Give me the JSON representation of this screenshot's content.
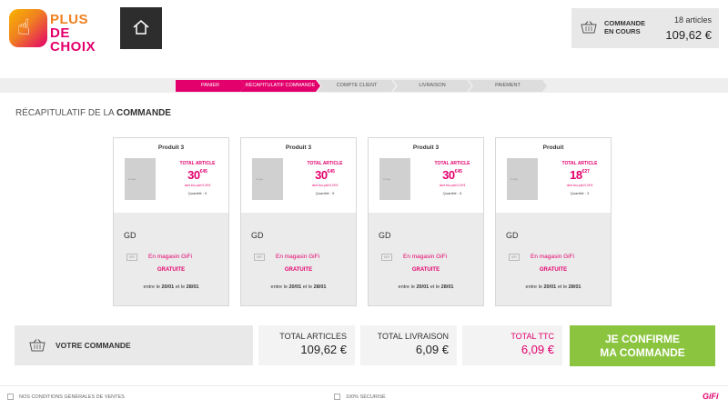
{
  "header": {
    "logo_line1": "PLUS",
    "logo_line2": "DE CHOIX",
    "cart_label": "COMMANDE EN COURS",
    "cart_count": "18 articles",
    "cart_total": "109,62 €"
  },
  "steps": [
    {
      "label": "PANIER",
      "active": true
    },
    {
      "label": "RÉCAPITULATIF COMMANDE",
      "active": true
    },
    {
      "label": "COMPTE CLIENT",
      "active": false
    },
    {
      "label": "LIVRAISON",
      "active": false
    },
    {
      "label": "PAIEMENT",
      "active": false
    }
  ],
  "section": {
    "prefix": "RÉCAPITULATIF DE LA",
    "strong": "COMMANDE"
  },
  "products": [
    {
      "title": "Produit 3",
      "image_text": "image",
      "total_label": "TOTAL ARTICLE",
      "price_int": "30",
      "price_dec": "45",
      "ecopart": "dont éco-part 0,09 €",
      "qty": "Quantité : 5",
      "seller": "GD",
      "gifi_label": "GiFi",
      "store": "En magasin GiFi",
      "shipping": "GRATUITE",
      "date_prefix": "entre le",
      "date_from": "20/01",
      "date_mid": "et le",
      "date_to": "28/01"
    },
    {
      "title": "Produit 3",
      "image_text": "image",
      "total_label": "TOTAL ARTICLE",
      "price_int": "30",
      "price_dec": "45",
      "ecopart": "dont éco-part 0,09 €",
      "qty": "Quantité : 5",
      "seller": "GD",
      "gifi_label": "GiFi",
      "store": "En magasin GiFi",
      "shipping": "GRATUITE",
      "date_prefix": "entre le",
      "date_from": "20/01",
      "date_mid": "et le",
      "date_to": "28/01"
    },
    {
      "title": "Produit 3",
      "image_text": "image",
      "total_label": "TOTAL ARTICLE",
      "price_int": "30",
      "price_dec": "45",
      "ecopart": "dont éco-part 0,09 €",
      "qty": "Quantité : 5",
      "seller": "GD",
      "gifi_label": "GiFi",
      "store": "En magasin GiFi",
      "shipping": "GRATUITE",
      "date_prefix": "entre le",
      "date_from": "20/01",
      "date_mid": "et le",
      "date_to": "28/01"
    },
    {
      "title": "Produit",
      "image_text": "image",
      "total_label": "TOTAL ARTICLE",
      "price_int": "18",
      "price_dec": "27",
      "ecopart": "dont éco-part 0,09 €",
      "qty": "Quantité : 3",
      "seller": "GD",
      "gifi_label": "GiFi",
      "store": "En magasin GiFi",
      "shipping": "GRATUITE",
      "date_prefix": "entre le",
      "date_from": "20/01",
      "date_mid": "et le",
      "date_to": "28/01"
    }
  ],
  "totals": {
    "order_label": "VOTRE COMMANDE",
    "articles_label": "TOTAL ARTICLES",
    "articles_value": "109,62 €",
    "shipping_label": "TOTAL LIVRAISON",
    "shipping_value": "6,09 €",
    "ttc_label": "TOTAL TTC",
    "ttc_value": "6,09 €",
    "confirm_line1": "JE CONFIRME",
    "confirm_line2": "MA COMMANDE"
  },
  "footer": {
    "conditions": "NOS CONDITIONS GÉNÉRALES DE VENTES",
    "secure": "100% SÉCURISÉ",
    "brand": "GiFi"
  },
  "colors": {
    "accent": "#e3006d",
    "orange": "#f08020",
    "confirm": "#8bc53f",
    "step_inactive": "#dddddd"
  }
}
